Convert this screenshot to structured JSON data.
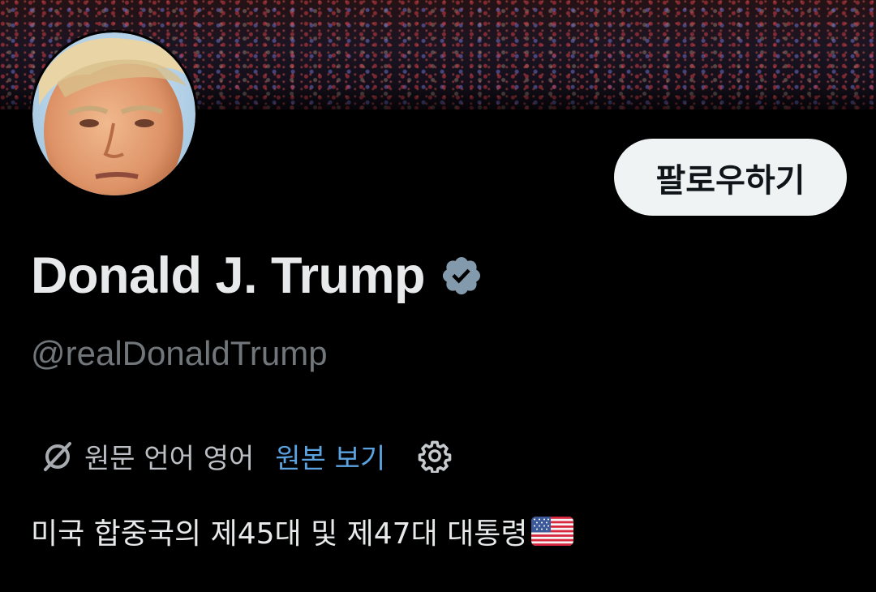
{
  "profile": {
    "display_name": "Donald J. Trump",
    "handle": "@realDonaldTrump",
    "verified": true,
    "verified_icon": "verified-badge-icon",
    "bio": "미국 합중국의 제45대 및 제47대 대통령",
    "bio_emoji": "us-flag-icon"
  },
  "actions": {
    "follow_label": "팔로우하기"
  },
  "translation": {
    "status_text": "원문 언어 영어",
    "view_original_label": "원본 보기",
    "icon": "translate-off-icon",
    "settings_icon": "gear-icon"
  },
  "colors": {
    "background": "#000000",
    "text_primary": "#e7e9ea",
    "text_secondary": "#71767b",
    "link": "#5ba3e0",
    "follow_button_bg": "#eff3f4",
    "verified_badge": "#829aab"
  }
}
